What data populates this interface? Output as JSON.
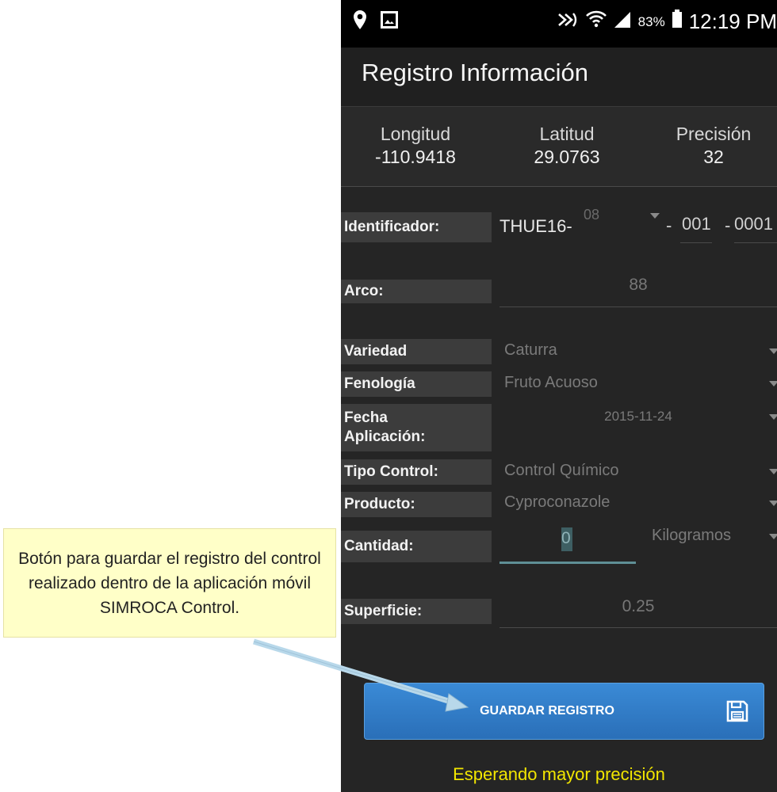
{
  "callout": {
    "text": "Botón para guardar el registro del control realizado dentro de la aplicación móvil SIMROCA Control."
  },
  "status_bar": {
    "left_icons": [
      "location-pin-icon",
      "image-icon"
    ],
    "right_icons": [
      "nfc-icon",
      "wifi-icon",
      "signal-icon",
      "battery-icon"
    ],
    "battery": "83%",
    "time": "12:19 PM"
  },
  "app": {
    "title": "Registro Información"
  },
  "coords": {
    "longitude_label": "Longitud",
    "longitude_value": "-110.9418",
    "latitude_label": "Latitud",
    "latitude_value": "29.0763",
    "precision_label": "Precisión",
    "precision_value": "32"
  },
  "form": {
    "identificador": {
      "label": "Identificador:",
      "prefix": "THUE16-",
      "selected": "08",
      "sep1": "-",
      "part2": "001",
      "sep2": "-",
      "part3": "0001"
    },
    "arco": {
      "label": "Arco:",
      "value": "88"
    },
    "variedad": {
      "label": "Variedad",
      "value": "Caturra"
    },
    "fenologia": {
      "label": "Fenología",
      "value": "Fruto Acuoso"
    },
    "fecha": {
      "label_line1": "Fecha",
      "label_line2": "Aplicación:",
      "value": "2015-11-24"
    },
    "tipo_control": {
      "label": "Tipo Control:",
      "value": "Control Químico"
    },
    "producto": {
      "label": "Producto:",
      "value": "Cyproconazole"
    },
    "cantidad": {
      "label": "Cantidad:",
      "value": "0",
      "unit": "Kilogramos"
    },
    "superficie": {
      "label": "Superficie:",
      "value": "0.25"
    }
  },
  "save_button": {
    "label": "GUARDAR REGISTRO",
    "icon": "save-icon"
  },
  "status_message": "Esperando mayor precisión",
  "colors": {
    "accent_button": "#2f7ec8",
    "status_message": "#f2e600",
    "callout_bg": "#ffffc8"
  }
}
